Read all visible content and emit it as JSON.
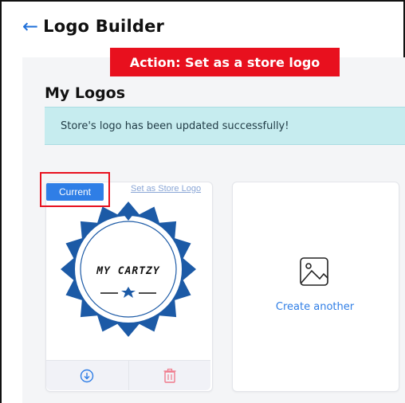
{
  "header": {
    "title": "Logo Builder",
    "back_icon": "arrow-left-icon"
  },
  "action_banner": {
    "text": "Action: Set as a store logo",
    "color": "#e8101e"
  },
  "section": {
    "title": "My Logos"
  },
  "alert": {
    "message": "Store's logo has been updated successfully!"
  },
  "logo_card": {
    "badge": "Current",
    "set_store_link": "Set as Store Logo",
    "logo_text": "MY CARTZY",
    "actions": [
      {
        "name": "download",
        "icon": "download-icon"
      },
      {
        "name": "delete",
        "icon": "trash-icon"
      }
    ]
  },
  "create_card": {
    "label": "Create another",
    "icon": "image-icon"
  },
  "colors": {
    "accent": "#2f7ee6",
    "logo_blue": "#1c5aa6",
    "alert_bg": "#c6ecef",
    "highlight": "#e8101e"
  }
}
